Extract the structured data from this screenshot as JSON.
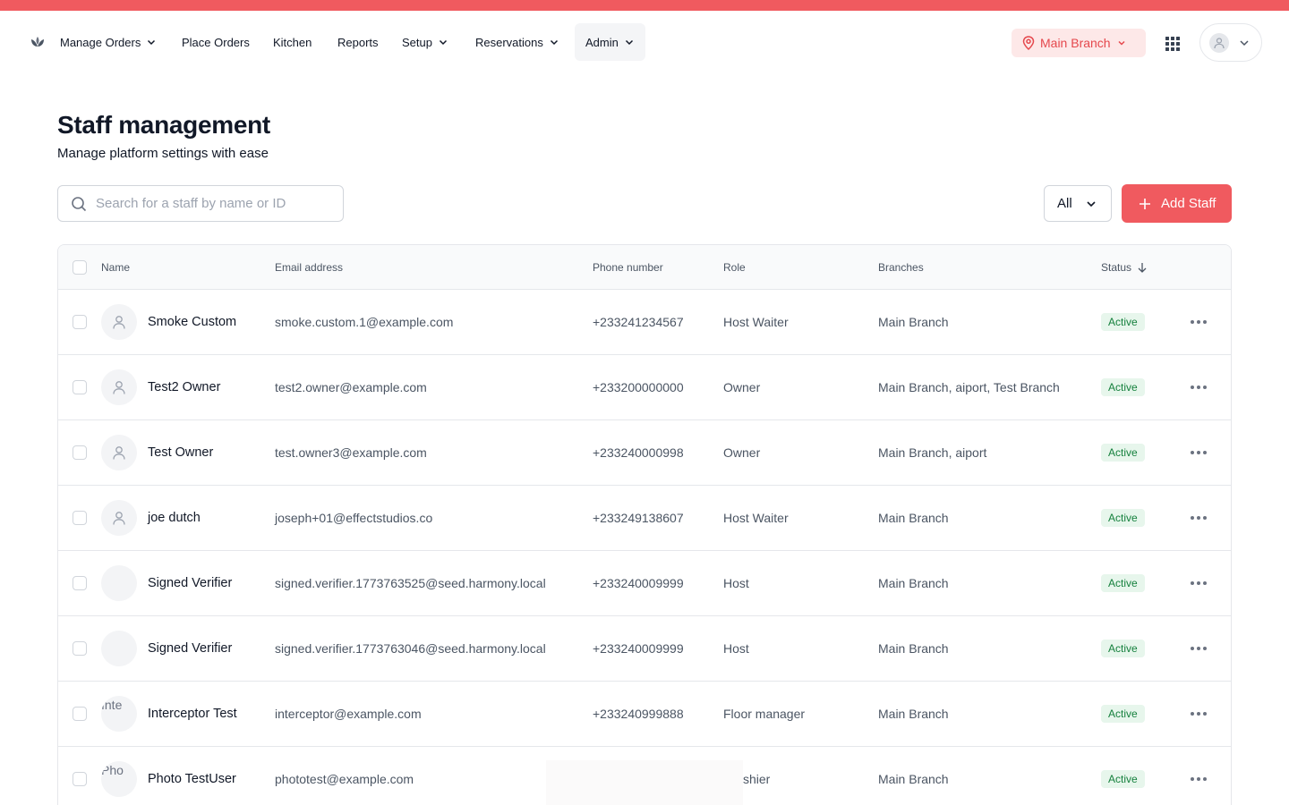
{
  "colors": {
    "accent": "#f05a5f",
    "status_active_bg": "#e7f6ec",
    "status_active_text": "#15803d"
  },
  "nav": {
    "logo_icon": "flower-logo-icon",
    "items": [
      {
        "label": "Manage Orders",
        "has_dropdown": true
      },
      {
        "label": "Place Orders",
        "has_dropdown": false
      },
      {
        "label": "Kitchen",
        "has_dropdown": false
      },
      {
        "label": "Reports",
        "has_dropdown": false
      },
      {
        "label": "Setup",
        "has_dropdown": true
      },
      {
        "label": "Reservations",
        "has_dropdown": true
      },
      {
        "label": "Admin",
        "has_dropdown": true,
        "active": true
      }
    ],
    "branch": "Main Branch"
  },
  "page": {
    "title": "Staff management",
    "subtitle": "Manage platform settings with ease"
  },
  "search": {
    "placeholder": "Search for a staff by name or ID",
    "value": ""
  },
  "filter": {
    "selected": "All"
  },
  "add_button": {
    "label": "Add Staff"
  },
  "table": {
    "columns": [
      "Name",
      "Email address",
      "Phone number",
      "Role",
      "Branches",
      "Status"
    ],
    "sort": {
      "column": "Status",
      "direction": "desc"
    },
    "rows": [
      {
        "name": "Smoke Custom",
        "email": "smoke.custom.1@example.com",
        "phone": "+233241234567",
        "role": "Host Waiter",
        "branches": "Main Branch",
        "status": "Active",
        "avatar": "user-placeholder-icon"
      },
      {
        "name": "Test2 Owner",
        "email": "test2.owner@example.com",
        "phone": "+233200000000",
        "role": "Owner",
        "branches": "Main Branch, aiport, Test Branch",
        "status": "Active",
        "avatar": "user-placeholder-icon"
      },
      {
        "name": "Test Owner",
        "email": "test.owner3@example.com",
        "phone": "+233240000998",
        "role": "Owner",
        "branches": "Main Branch, aiport",
        "status": "Active",
        "avatar": "user-placeholder-icon"
      },
      {
        "name": "joe dutch",
        "email": "joseph+01@effectstudios.co",
        "phone": "+233249138607",
        "role": "Host Waiter",
        "branches": "Main Branch",
        "status": "Active",
        "avatar": "user-placeholder-icon"
      },
      {
        "name": "Signed Verifier",
        "email": "signed.verifier.1773763525@seed.harmony.local",
        "phone": "+233240009999",
        "role": "Host",
        "branches": "Main Branch",
        "status": "Active",
        "avatar": "blank"
      },
      {
        "name": "Signed Verifier",
        "email": "signed.verifier.1773763046@seed.harmony.local",
        "phone": "+233240009999",
        "role": "Host",
        "branches": "Main Branch",
        "status": "Active",
        "avatar": "blank"
      },
      {
        "name": "Interceptor Test",
        "email": "interceptor@example.com",
        "phone": "+233240999888",
        "role": "Floor manager",
        "branches": "Main Branch",
        "status": "Active",
        "avatar": "broken-image",
        "avatar_alt": "Inte"
      },
      {
        "name": "Photo TestUser",
        "email": "phototest@example.com",
        "phone": "",
        "role": "shier",
        "branches": "Main Branch",
        "status": "Active",
        "avatar": "broken-image",
        "avatar_alt": "Pho"
      }
    ]
  }
}
